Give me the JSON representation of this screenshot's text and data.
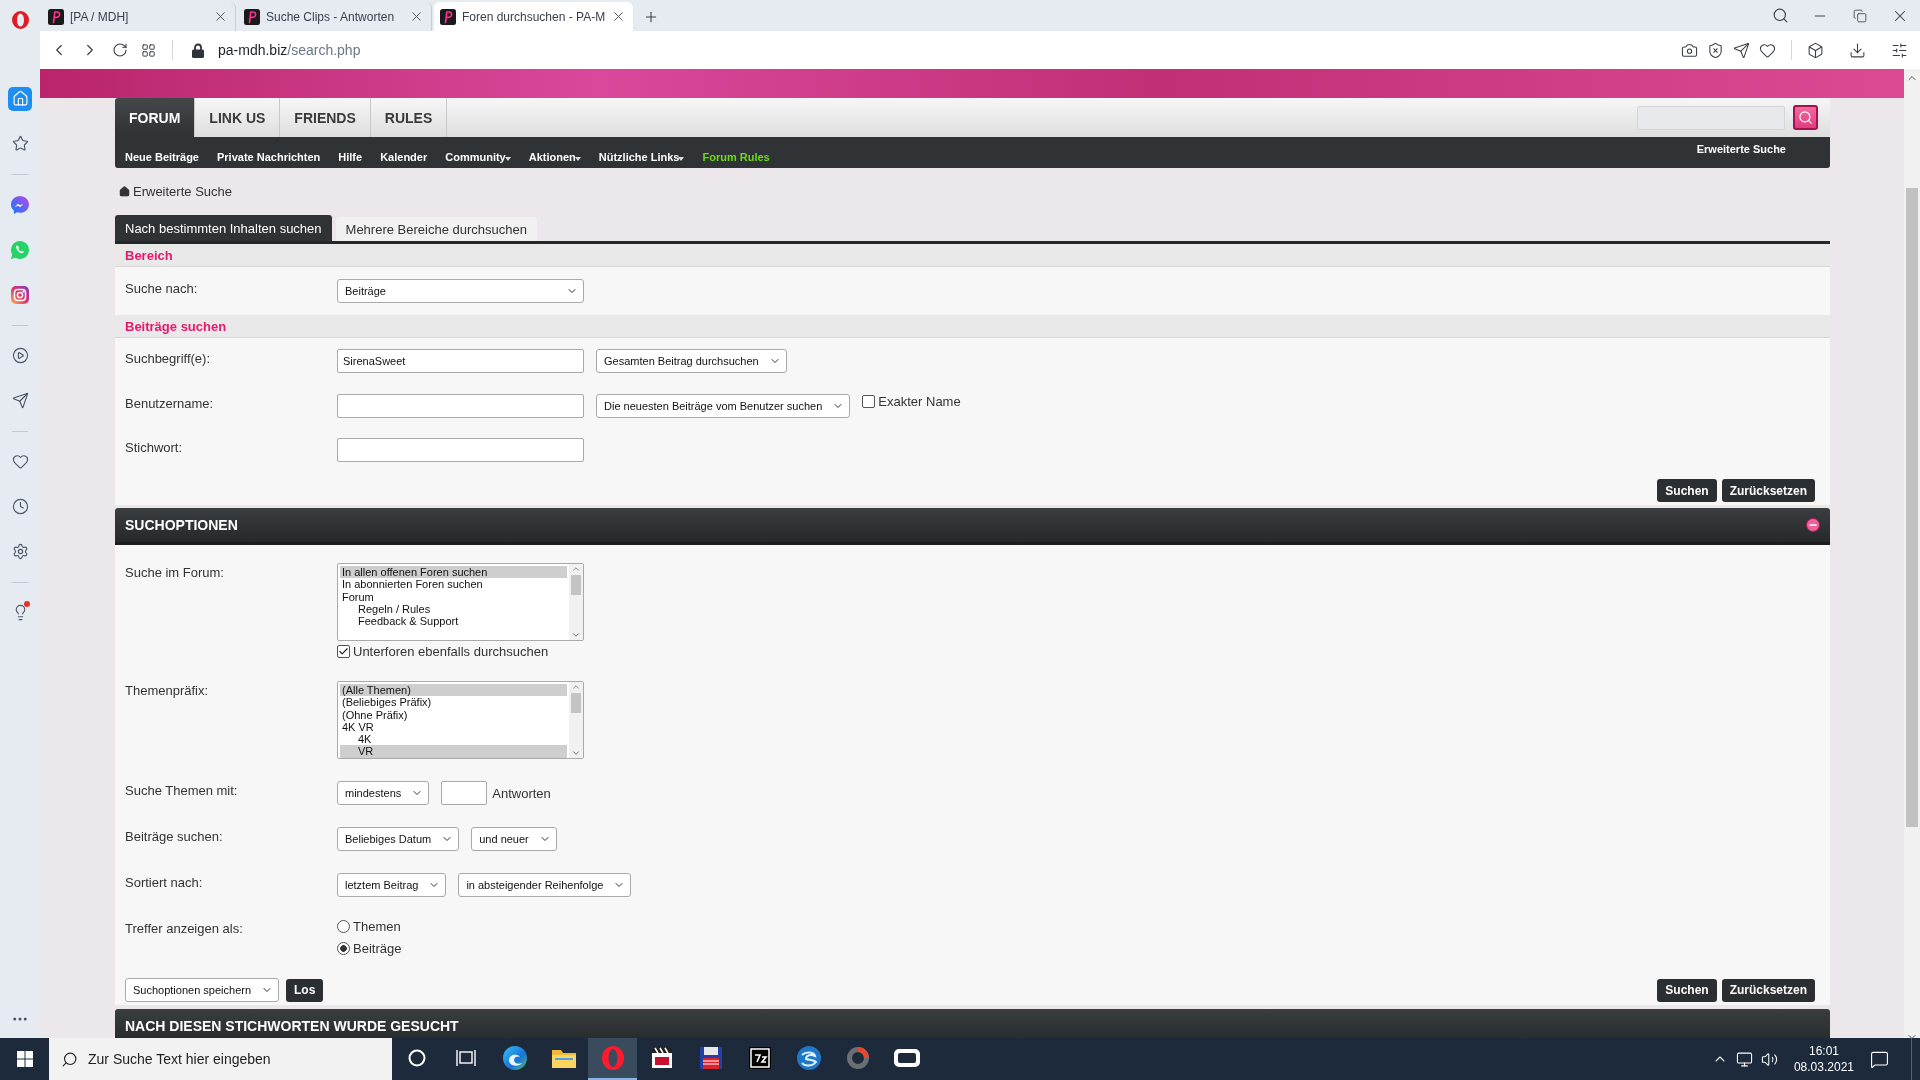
{
  "browser": {
    "tabs": [
      {
        "title": "[PA / MDH]",
        "selected": false
      },
      {
        "title": "Suche Clips - Antworten",
        "selected": false
      },
      {
        "title": "Foren durchsuchen - PA-M",
        "selected": true
      }
    ],
    "address": {
      "host": "pa-mdh.biz",
      "path": "/search.php"
    }
  },
  "sidebar": {
    "items": [
      {
        "selected": true,
        "alert": false
      },
      {
        "selected": false,
        "alert": false
      },
      {
        "selected": false,
        "alert": false
      },
      {
        "selected": false,
        "alert": false
      },
      {
        "selected": false,
        "alert": false
      },
      {
        "selected": false,
        "alert": false
      },
      {
        "selected": false,
        "alert": false
      },
      {
        "selected": false,
        "alert": false
      },
      {
        "selected": false,
        "alert": false
      },
      {
        "selected": false,
        "alert": false
      },
      {
        "selected": false,
        "alert": true
      }
    ]
  },
  "forum": {
    "nav": [
      {
        "label": "FORUM",
        "selected": true
      },
      {
        "label": "LINK US",
        "selected": false
      },
      {
        "label": "FRIENDS",
        "selected": false
      },
      {
        "label": "RULES",
        "selected": false
      }
    ],
    "subnav": [
      {
        "label": "Neue Beiträge",
        "dropdown": false,
        "highlight": false
      },
      {
        "label": "Private Nachrichten",
        "dropdown": false,
        "highlight": false
      },
      {
        "label": "Hilfe",
        "dropdown": false,
        "highlight": false
      },
      {
        "label": "Kalender",
        "dropdown": false,
        "highlight": false
      },
      {
        "label": "Community",
        "dropdown": true,
        "highlight": false
      },
      {
        "label": "Aktionen",
        "dropdown": true,
        "highlight": false
      },
      {
        "label": "Nützliche Links",
        "dropdown": true,
        "highlight": false
      },
      {
        "label": "Forum Rules",
        "dropdown": false,
        "highlight": true
      }
    ],
    "subnav_right": "Erweiterte Suche"
  },
  "breadcrumb": "Erweiterte Suche",
  "search_tabs": [
    {
      "label": "Nach bestimmten Inhalten suchen",
      "selected": true
    },
    {
      "label": "Mehrere Bereiche durchsuchen",
      "selected": false
    }
  ],
  "search_form": {
    "groups": [
      {
        "heading": "Bereich",
        "rows": [
          {
            "label": "Suche nach:",
            "controls": [
              {
                "kind": "wide_select",
                "value": "Beiträge"
              }
            ]
          }
        ]
      },
      {
        "heading": "Beiträge suchen",
        "rows": [
          {
            "label": "Suchbegriff(e):",
            "controls": [
              {
                "kind": "input",
                "value": "SirenaSweet"
              },
              {
                "kind": "select",
                "value": "Gesamten Beitrag durchsuchen"
              }
            ]
          },
          {
            "label": "Benutzername:",
            "controls": [
              {
                "kind": "input"
              },
              {
                "kind": "select",
                "value": "Die neuesten Beiträge vom Benutzer suchen"
              },
              {
                "kind": "checkbox",
                "label": "Exakter Name",
                "checked": false
              }
            ]
          },
          {
            "label": "Stichwort:",
            "controls": [
              {
                "kind": "input"
              }
            ]
          }
        ]
      }
    ],
    "buttons": [
      "Suchen",
      "Zurücksetzen"
    ]
  },
  "search_options": {
    "title": "SUCHOPTIONEN",
    "expanded": true,
    "rows": [
      {
        "kind": "stack",
        "label": "Suche im Forum:",
        "controls": [
          {
            "kind": "listbox",
            "options": [
              {
                "label": "In allen offenen Foren suchen",
                "selected": true
              },
              {
                "label": "In abonnierten Foren suchen",
                "selected": false
              },
              {
                "label": "Forum",
                "selected": false,
                "children": [
                  {
                    "label": "Regeln / Rules",
                    "selected": false
                  },
                  {
                    "label": "Feedback & Support",
                    "selected": false
                  }
                ]
              }
            ]
          },
          {
            "kind": "checkbox",
            "label": "Unterforen ebenfalls durchsuchen",
            "checked": true
          }
        ]
      },
      {
        "kind": "inline",
        "label": "Themenpräfix:",
        "controls": [
          {
            "kind": "listbox",
            "options": [
              {
                "label": "(Alle Themen)",
                "selected": true
              },
              {
                "label": "(Beliebiges Präfix)",
                "selected": false
              },
              {
                "label": "(Ohne Präfix)",
                "selected": false
              },
              {
                "label": "4K VR",
                "selected": false,
                "children": [
                  {
                    "label": "4K",
                    "selected": false
                  },
                  {
                    "label": "VR",
                    "selected": true
                  }
                ]
              }
            ]
          }
        ]
      },
      {
        "kind": "inline",
        "label": "Suche Themen mit:",
        "controls": [
          {
            "kind": "select",
            "value": "mindestens"
          },
          {
            "kind": "short_input"
          },
          {
            "kind": "text",
            "text": "Antworten"
          }
        ]
      },
      {
        "kind": "inline",
        "label": "Beiträge suchen:",
        "controls": [
          {
            "kind": "select",
            "value": "Beliebiges Datum"
          },
          {
            "kind": "select",
            "value": "und neuer"
          }
        ]
      },
      {
        "kind": "inline",
        "label": "Sortiert nach:",
        "controls": [
          {
            "kind": "select",
            "value": "letztem Beitrag"
          },
          {
            "kind": "select",
            "value": "in absteigender Reihenfolge"
          }
        ]
      },
      {
        "kind": "stack",
        "label": "Treffer anzeigen als:",
        "controls": [
          {
            "kind": "radio",
            "label": "Themen",
            "selected": false
          },
          {
            "kind": "radio",
            "label": "Beiträge",
            "selected": true
          }
        ]
      }
    ],
    "save": {
      "value": "Suchoptionen speichern"
    },
    "save_button": "Los",
    "buttons": [
      "Suchen",
      "Zurücksetzen"
    ]
  },
  "results_header": "NACH DIESEN STICHWORTEN WURDE GESUCHT",
  "taskbar": {
    "search": {
      "placeholder": "Zur Suche Text hier eingeben"
    },
    "apps": [
      {
        "selected": false
      },
      {
        "selected": false
      },
      {
        "selected": false
      },
      {
        "selected": false
      },
      {
        "selected": true
      },
      {
        "selected": false
      },
      {
        "selected": false
      },
      {
        "selected": false
      },
      {
        "selected": false
      },
      {
        "selected": false
      },
      {
        "selected": false
      }
    ],
    "time": "16:01",
    "date": "08.03.2021"
  }
}
